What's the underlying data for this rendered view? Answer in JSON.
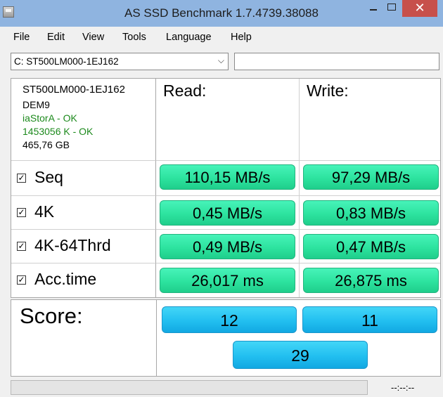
{
  "window": {
    "title": "AS SSD Benchmark 1.7.4739.38088",
    "close_glyph": "✕"
  },
  "menu": [
    "File",
    "Edit",
    "View",
    "Tools",
    "Language",
    "Help"
  ],
  "drive": {
    "selected": "C: ST500LM000-1EJ162",
    "arrow": "⌵",
    "text_value": ""
  },
  "device_info": {
    "model": "ST500LM000-1EJ162",
    "firmware": "DEM9",
    "driver": "iaStorA - OK",
    "alignment": "1453056 K - OK",
    "size": "465,76 GB"
  },
  "headers": {
    "read": "Read:",
    "write": "Write:"
  },
  "check_glyph": "✓",
  "rows": [
    {
      "label": "Seq",
      "read": "110,15 MB/s",
      "write": "97,29 MB/s"
    },
    {
      "label": "4K",
      "read": "0,45 MB/s",
      "write": "0,83 MB/s"
    },
    {
      "label": "4K-64Thrd",
      "read": "0,49 MB/s",
      "write": "0,47 MB/s"
    },
    {
      "label": "Acc.time",
      "read": "26,017 ms",
      "write": "26,875 ms"
    }
  ],
  "score": {
    "label": "Score:",
    "read": "12",
    "write": "11",
    "total": "29"
  },
  "status": {
    "timer": "--:--:--",
    "progress": 0
  },
  "colors": {
    "value_green": "#2de39f",
    "score_blue": "#22bff0",
    "titlebar": "#8fb4e0",
    "close_red": "#c7504b"
  }
}
